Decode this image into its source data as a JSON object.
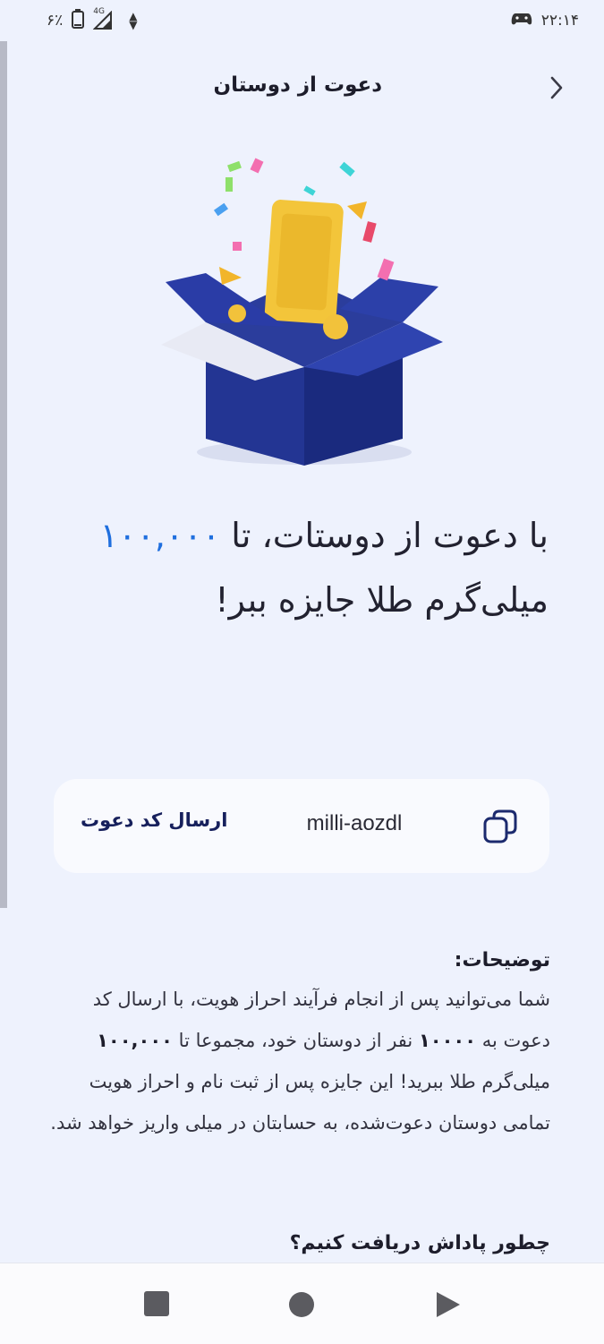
{
  "status_bar": {
    "battery_percent": "۶٪",
    "network": "4G",
    "time": "۲۲:۱۴"
  },
  "header": {
    "title": "دعوت از دوستان",
    "back_icon": "chevron-right-icon"
  },
  "hero": {
    "image": "open-gift-box-with-gold-bar-and-confetti"
  },
  "headline": {
    "part1": "با دعوت از دوستات، تا",
    "amount": "۱۰۰,۰۰۰",
    "part2": " میلی‌گرم طلا جایزه ببر!"
  },
  "invite": {
    "code": "milli-aozdl",
    "send_label": "ارسال کد دعوت",
    "copy_icon": "copy-icon"
  },
  "description": {
    "title": "توضیحات:",
    "body_1": "شما می‌توانید پس از انجام فرآیند احراز هویت، با ارسال کد دعوت به ",
    "count": "۱۰۰۰۰",
    "body_2": " نفر از دوستان خود، مجموعا تا ",
    "amount": "۱۰۰,۰۰۰",
    "body_3": " میلی‌گرم طلا ببرید! این جایزه پس از ثبت نام و احراز هویت تمامی دوستان دعوت‌شده، به حسابتان در میلی واریز خواهد شد."
  },
  "how_to": {
    "title": "چطور پاداش دریافت کنیم؟"
  },
  "nav": {
    "recents_icon": "square-icon",
    "home_icon": "circle-icon",
    "back_icon": "triangle-back-icon"
  }
}
